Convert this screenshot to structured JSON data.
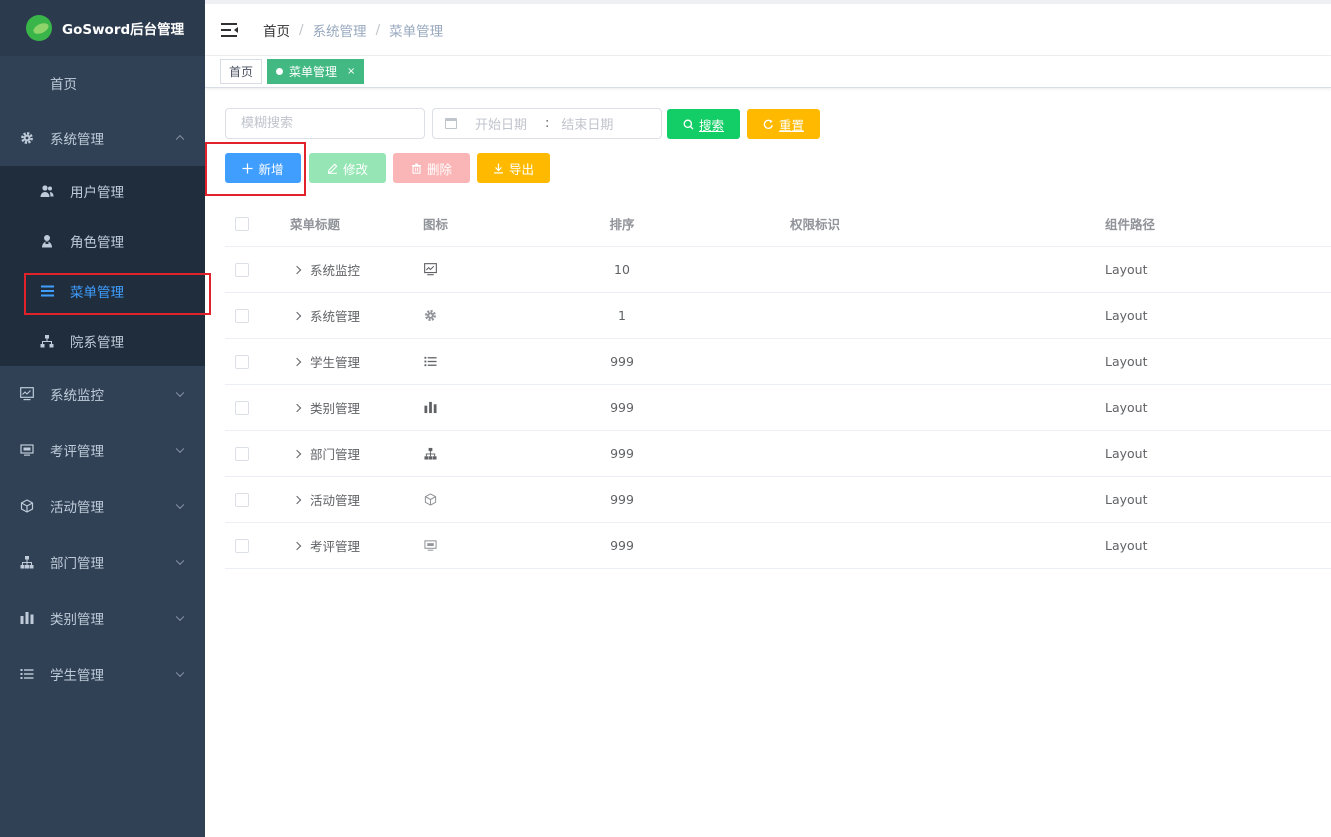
{
  "app": {
    "title": "GoSword后台管理"
  },
  "colors": {
    "sidebar_bg": "#304156",
    "active": "#409eff",
    "success": "#13ce66",
    "warning": "#ffba00",
    "tag_active": "#42b983"
  },
  "sidebar": {
    "home": "首页",
    "items": [
      {
        "label": "系统管理",
        "icon": "gear-icon",
        "expanded": true
      },
      {
        "label": "系统监控",
        "icon": "monitor-icon"
      },
      {
        "label": "考评管理",
        "icon": "screen-icon"
      },
      {
        "label": "活动管理",
        "icon": "cube-icon"
      },
      {
        "label": "部门管理",
        "icon": "tree-icon"
      },
      {
        "label": "类别管理",
        "icon": "bar-chart-icon"
      },
      {
        "label": "学生管理",
        "icon": "list-icon"
      }
    ],
    "submenu": [
      {
        "label": "用户管理",
        "icon": "users-icon"
      },
      {
        "label": "角色管理",
        "icon": "role-icon"
      },
      {
        "label": "菜单管理",
        "icon": "menu-lines-icon",
        "active": true
      },
      {
        "label": "院系管理",
        "icon": "org-icon"
      }
    ]
  },
  "header": {
    "breadcrumb": [
      "首页",
      "系统管理",
      "菜单管理"
    ],
    "separator": "/"
  },
  "tags": [
    {
      "label": "首页"
    },
    {
      "label": "菜单管理",
      "active": true,
      "close": "×"
    }
  ],
  "search": {
    "fuzzy_placeholder": "模糊搜索",
    "start_placeholder": "开始日期",
    "range_separator": ":",
    "end_placeholder": "结束日期",
    "search_label": "搜索",
    "reset_label": "重置"
  },
  "toolbar": {
    "add_label": "新增",
    "edit_label": "修改",
    "delete_label": "删除",
    "export_label": "导出"
  },
  "table": {
    "columns": [
      "菜单标题",
      "图标",
      "排序",
      "权限标识",
      "组件路径"
    ],
    "rows": [
      {
        "title": "系统监控",
        "icon": "monitor-icon",
        "order": "10",
        "perm": "",
        "component": "Layout"
      },
      {
        "title": "系统管理",
        "icon": "gear-icon",
        "order": "1",
        "perm": "",
        "component": "Layout"
      },
      {
        "title": "学生管理",
        "icon": "list-icon",
        "order": "999",
        "perm": "",
        "component": "Layout"
      },
      {
        "title": "类别管理",
        "icon": "bar-chart-icon",
        "order": "999",
        "perm": "",
        "component": "Layout"
      },
      {
        "title": "部门管理",
        "icon": "tree-icon",
        "order": "999",
        "perm": "",
        "component": "Layout"
      },
      {
        "title": "活动管理",
        "icon": "cube-icon",
        "order": "999",
        "perm": "",
        "component": "Layout"
      },
      {
        "title": "考评管理",
        "icon": "screen-icon",
        "order": "999",
        "perm": "",
        "component": "Layout"
      }
    ]
  }
}
